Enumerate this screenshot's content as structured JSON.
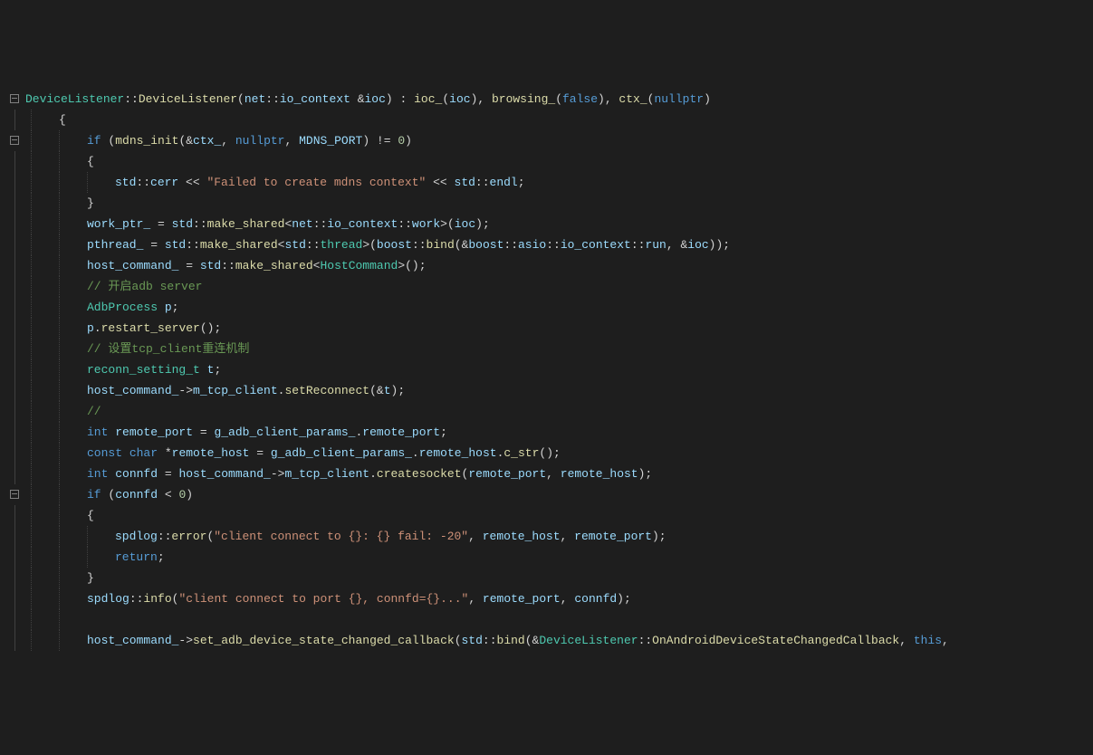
{
  "lines": [
    {
      "fold": "minus",
      "indent": 0,
      "tokens": [
        {
          "c": "c-type",
          "t": "DeviceListener"
        },
        {
          "c": "c-punc",
          "t": "::"
        },
        {
          "c": "c-fn",
          "t": "DeviceListener"
        },
        {
          "c": "c-punc",
          "t": "("
        },
        {
          "c": "c-id",
          "t": "net"
        },
        {
          "c": "c-punc",
          "t": "::"
        },
        {
          "c": "c-id",
          "t": "io_context"
        },
        {
          "c": "c-punc",
          "t": " &"
        },
        {
          "c": "c-id",
          "t": "ioc"
        },
        {
          "c": "c-punc",
          "t": ") : "
        },
        {
          "c": "c-fn",
          "t": "ioc_"
        },
        {
          "c": "c-punc",
          "t": "("
        },
        {
          "c": "c-id",
          "t": "ioc"
        },
        {
          "c": "c-punc",
          "t": "), "
        },
        {
          "c": "c-fn",
          "t": "browsing_"
        },
        {
          "c": "c-punc",
          "t": "("
        },
        {
          "c": "c-kw",
          "t": "false"
        },
        {
          "c": "c-punc",
          "t": "), "
        },
        {
          "c": "c-fn",
          "t": "ctx_"
        },
        {
          "c": "c-punc",
          "t": "("
        },
        {
          "c": "c-kw",
          "t": "nullptr"
        },
        {
          "c": "c-punc",
          "t": ")"
        }
      ]
    },
    {
      "fold": "",
      "indent": 1,
      "tokens": [
        {
          "c": "c-punc",
          "t": "{"
        }
      ]
    },
    {
      "fold": "minus",
      "indent": 2,
      "tokens": [
        {
          "c": "c-kw",
          "t": "if"
        },
        {
          "c": "c-punc",
          "t": " ("
        },
        {
          "c": "c-fn",
          "t": "mdns_init"
        },
        {
          "c": "c-punc",
          "t": "(&"
        },
        {
          "c": "c-id",
          "t": "ctx_"
        },
        {
          "c": "c-punc",
          "t": ", "
        },
        {
          "c": "c-kw",
          "t": "nullptr"
        },
        {
          "c": "c-punc",
          "t": ", "
        },
        {
          "c": "c-id",
          "t": "MDNS_PORT"
        },
        {
          "c": "c-punc",
          "t": ") != "
        },
        {
          "c": "c-num",
          "t": "0"
        },
        {
          "c": "c-punc",
          "t": ")"
        }
      ]
    },
    {
      "fold": "",
      "indent": 2,
      "tokens": [
        {
          "c": "c-punc",
          "t": "{"
        }
      ]
    },
    {
      "fold": "",
      "indent": 3,
      "tokens": [
        {
          "c": "c-id",
          "t": "std"
        },
        {
          "c": "c-punc",
          "t": "::"
        },
        {
          "c": "c-id",
          "t": "cerr"
        },
        {
          "c": "c-punc",
          "t": " << "
        },
        {
          "c": "c-str",
          "t": "\"Failed to create mdns context\""
        },
        {
          "c": "c-punc",
          "t": " << "
        },
        {
          "c": "c-id",
          "t": "std"
        },
        {
          "c": "c-punc",
          "t": "::"
        },
        {
          "c": "c-id",
          "t": "endl"
        },
        {
          "c": "c-punc",
          "t": ";"
        }
      ]
    },
    {
      "fold": "",
      "indent": 2,
      "tokens": [
        {
          "c": "c-punc",
          "t": "}"
        }
      ]
    },
    {
      "fold": "",
      "indent": 2,
      "tokens": [
        {
          "c": "c-id",
          "t": "work_ptr_"
        },
        {
          "c": "c-punc",
          "t": " = "
        },
        {
          "c": "c-id",
          "t": "std"
        },
        {
          "c": "c-punc",
          "t": "::"
        },
        {
          "c": "c-fn",
          "t": "make_shared"
        },
        {
          "c": "c-punc",
          "t": "<"
        },
        {
          "c": "c-id",
          "t": "net"
        },
        {
          "c": "c-punc",
          "t": "::"
        },
        {
          "c": "c-id",
          "t": "io_context"
        },
        {
          "c": "c-punc",
          "t": "::"
        },
        {
          "c": "c-id",
          "t": "work"
        },
        {
          "c": "c-punc",
          "t": ">("
        },
        {
          "c": "c-id",
          "t": "ioc"
        },
        {
          "c": "c-punc",
          "t": ");"
        }
      ]
    },
    {
      "fold": "",
      "indent": 2,
      "tokens": [
        {
          "c": "c-id",
          "t": "pthread_"
        },
        {
          "c": "c-punc",
          "t": " = "
        },
        {
          "c": "c-id",
          "t": "std"
        },
        {
          "c": "c-punc",
          "t": "::"
        },
        {
          "c": "c-fn",
          "t": "make_shared"
        },
        {
          "c": "c-punc",
          "t": "<"
        },
        {
          "c": "c-id",
          "t": "std"
        },
        {
          "c": "c-punc",
          "t": "::"
        },
        {
          "c": "c-type",
          "t": "thread"
        },
        {
          "c": "c-punc",
          "t": ">("
        },
        {
          "c": "c-id",
          "t": "boost"
        },
        {
          "c": "c-punc",
          "t": "::"
        },
        {
          "c": "c-fn",
          "t": "bind"
        },
        {
          "c": "c-punc",
          "t": "(&"
        },
        {
          "c": "c-id",
          "t": "boost"
        },
        {
          "c": "c-punc",
          "t": "::"
        },
        {
          "c": "c-id",
          "t": "asio"
        },
        {
          "c": "c-punc",
          "t": "::"
        },
        {
          "c": "c-id",
          "t": "io_context"
        },
        {
          "c": "c-punc",
          "t": "::"
        },
        {
          "c": "c-id",
          "t": "run"
        },
        {
          "c": "c-punc",
          "t": ", &"
        },
        {
          "c": "c-id",
          "t": "ioc"
        },
        {
          "c": "c-punc",
          "t": "));"
        }
      ]
    },
    {
      "fold": "",
      "indent": 2,
      "tokens": [
        {
          "c": "c-id",
          "t": "host_command_"
        },
        {
          "c": "c-punc",
          "t": " = "
        },
        {
          "c": "c-id",
          "t": "std"
        },
        {
          "c": "c-punc",
          "t": "::"
        },
        {
          "c": "c-fn",
          "t": "make_shared"
        },
        {
          "c": "c-punc",
          "t": "<"
        },
        {
          "c": "c-type",
          "t": "HostCommand"
        },
        {
          "c": "c-punc",
          "t": ">();"
        }
      ]
    },
    {
      "fold": "",
      "indent": 2,
      "tokens": [
        {
          "c": "c-cmt",
          "t": "// 开启adb server"
        }
      ]
    },
    {
      "fold": "",
      "indent": 2,
      "tokens": [
        {
          "c": "c-type",
          "t": "AdbProcess"
        },
        {
          "c": "c-punc",
          "t": " "
        },
        {
          "c": "c-id",
          "t": "p"
        },
        {
          "c": "c-punc",
          "t": ";"
        }
      ]
    },
    {
      "fold": "",
      "indent": 2,
      "tokens": [
        {
          "c": "c-id",
          "t": "p"
        },
        {
          "c": "c-punc",
          "t": "."
        },
        {
          "c": "c-fn",
          "t": "restart_server"
        },
        {
          "c": "c-punc",
          "t": "();"
        }
      ]
    },
    {
      "fold": "",
      "indent": 2,
      "tokens": [
        {
          "c": "c-cmt",
          "t": "// 设置tcp_client重连机制"
        }
      ]
    },
    {
      "fold": "",
      "indent": 2,
      "tokens": [
        {
          "c": "c-type",
          "t": "reconn_setting_t"
        },
        {
          "c": "c-punc",
          "t": " "
        },
        {
          "c": "c-id",
          "t": "t"
        },
        {
          "c": "c-punc",
          "t": ";"
        }
      ]
    },
    {
      "fold": "",
      "indent": 2,
      "tokens": [
        {
          "c": "c-id",
          "t": "host_command_"
        },
        {
          "c": "c-punc",
          "t": "->"
        },
        {
          "c": "c-id",
          "t": "m_tcp_client"
        },
        {
          "c": "c-punc",
          "t": "."
        },
        {
          "c": "c-fn",
          "t": "setReconnect"
        },
        {
          "c": "c-punc",
          "t": "(&"
        },
        {
          "c": "c-id",
          "t": "t"
        },
        {
          "c": "c-punc",
          "t": ");"
        }
      ]
    },
    {
      "fold": "",
      "indent": 2,
      "tokens": [
        {
          "c": "c-cmt",
          "t": "//"
        }
      ]
    },
    {
      "fold": "",
      "indent": 2,
      "tokens": [
        {
          "c": "c-kw",
          "t": "int"
        },
        {
          "c": "c-punc",
          "t": " "
        },
        {
          "c": "c-id",
          "t": "remote_port"
        },
        {
          "c": "c-punc",
          "t": " = "
        },
        {
          "c": "c-id",
          "t": "g_adb_client_params_"
        },
        {
          "c": "c-punc",
          "t": "."
        },
        {
          "c": "c-id",
          "t": "remote_port"
        },
        {
          "c": "c-punc",
          "t": ";"
        }
      ]
    },
    {
      "fold": "",
      "indent": 2,
      "tokens": [
        {
          "c": "c-kw",
          "t": "const"
        },
        {
          "c": "c-punc",
          "t": " "
        },
        {
          "c": "c-kw",
          "t": "char"
        },
        {
          "c": "c-punc",
          "t": " *"
        },
        {
          "c": "c-id",
          "t": "remote_host"
        },
        {
          "c": "c-punc",
          "t": " = "
        },
        {
          "c": "c-id",
          "t": "g_adb_client_params_"
        },
        {
          "c": "c-punc",
          "t": "."
        },
        {
          "c": "c-id",
          "t": "remote_host"
        },
        {
          "c": "c-punc",
          "t": "."
        },
        {
          "c": "c-fn",
          "t": "c_str"
        },
        {
          "c": "c-punc",
          "t": "();"
        }
      ]
    },
    {
      "fold": "",
      "indent": 2,
      "tokens": [
        {
          "c": "c-kw",
          "t": "int"
        },
        {
          "c": "c-punc",
          "t": " "
        },
        {
          "c": "c-id",
          "t": "connfd"
        },
        {
          "c": "c-punc",
          "t": " = "
        },
        {
          "c": "c-id",
          "t": "host_command_"
        },
        {
          "c": "c-punc",
          "t": "->"
        },
        {
          "c": "c-id",
          "t": "m_tcp_client"
        },
        {
          "c": "c-punc",
          "t": "."
        },
        {
          "c": "c-fn",
          "t": "createsocket"
        },
        {
          "c": "c-punc",
          "t": "("
        },
        {
          "c": "c-id",
          "t": "remote_port"
        },
        {
          "c": "c-punc",
          "t": ", "
        },
        {
          "c": "c-id",
          "t": "remote_host"
        },
        {
          "c": "c-punc",
          "t": ");"
        }
      ]
    },
    {
      "fold": "minus",
      "indent": 2,
      "tokens": [
        {
          "c": "c-kw",
          "t": "if"
        },
        {
          "c": "c-punc",
          "t": " ("
        },
        {
          "c": "c-id",
          "t": "connfd"
        },
        {
          "c": "c-punc",
          "t": " < "
        },
        {
          "c": "c-num",
          "t": "0"
        },
        {
          "c": "c-punc",
          "t": ")"
        }
      ]
    },
    {
      "fold": "",
      "indent": 2,
      "tokens": [
        {
          "c": "c-punc",
          "t": "{"
        }
      ]
    },
    {
      "fold": "",
      "indent": 3,
      "tokens": [
        {
          "c": "c-id",
          "t": "spdlog"
        },
        {
          "c": "c-punc",
          "t": "::"
        },
        {
          "c": "c-fn",
          "t": "error"
        },
        {
          "c": "c-punc",
          "t": "("
        },
        {
          "c": "c-str",
          "t": "\"client connect to {}: {} fail: -20\""
        },
        {
          "c": "c-punc",
          "t": ", "
        },
        {
          "c": "c-id",
          "t": "remote_host"
        },
        {
          "c": "c-punc",
          "t": ", "
        },
        {
          "c": "c-id",
          "t": "remote_port"
        },
        {
          "c": "c-punc",
          "t": ");"
        }
      ]
    },
    {
      "fold": "",
      "indent": 3,
      "tokens": [
        {
          "c": "c-kw",
          "t": "return"
        },
        {
          "c": "c-punc",
          "t": ";"
        }
      ]
    },
    {
      "fold": "",
      "indent": 2,
      "tokens": [
        {
          "c": "c-punc",
          "t": "}"
        }
      ]
    },
    {
      "fold": "",
      "indent": 2,
      "tokens": [
        {
          "c": "c-id",
          "t": "spdlog"
        },
        {
          "c": "c-punc",
          "t": "::"
        },
        {
          "c": "c-fn",
          "t": "info"
        },
        {
          "c": "c-punc",
          "t": "("
        },
        {
          "c": "c-str",
          "t": "\"client connect to port {}, connfd={}...\""
        },
        {
          "c": "c-punc",
          "t": ", "
        },
        {
          "c": "c-id",
          "t": "remote_port"
        },
        {
          "c": "c-punc",
          "t": ", "
        },
        {
          "c": "c-id",
          "t": "connfd"
        },
        {
          "c": "c-punc",
          "t": ");"
        }
      ]
    },
    {
      "fold": "",
      "indent": 2,
      "tokens": []
    },
    {
      "fold": "",
      "indent": 2,
      "tokens": [
        {
          "c": "c-id",
          "t": "host_command_"
        },
        {
          "c": "c-punc",
          "t": "->"
        },
        {
          "c": "c-fn",
          "t": "set_adb_device_state_changed_callback"
        },
        {
          "c": "c-punc",
          "t": "("
        },
        {
          "c": "c-id",
          "t": "std"
        },
        {
          "c": "c-punc",
          "t": "::"
        },
        {
          "c": "c-fn",
          "t": "bind"
        },
        {
          "c": "c-punc",
          "t": "(&"
        },
        {
          "c": "c-type",
          "t": "DeviceListener"
        },
        {
          "c": "c-punc",
          "t": "::"
        },
        {
          "c": "c-fn",
          "t": "OnAndroidDeviceStateChangedCallback"
        },
        {
          "c": "c-punc",
          "t": ", "
        },
        {
          "c": "c-kw",
          "t": "this"
        },
        {
          "c": "c-punc",
          "t": ","
        }
      ]
    }
  ]
}
